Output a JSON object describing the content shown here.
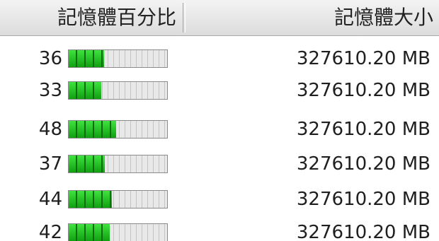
{
  "header": {
    "memory_percent_label": "記憶體百分比",
    "memory_size_label": "記憶體大小"
  },
  "rows": [
    {
      "percent": "36",
      "size": "327610.20 MB"
    },
    {
      "percent": "33",
      "size": "327610.20 MB"
    },
    {
      "percent": "48",
      "size": "327610.20 MB"
    },
    {
      "percent": "37",
      "size": "327610.20 MB"
    },
    {
      "percent": "44",
      "size": "327610.20 MB"
    },
    {
      "percent": "42",
      "size": "327610.20 MB"
    }
  ],
  "colors": {
    "bar_fill": "#18b818",
    "bar_empty": "#e8e8e8"
  }
}
